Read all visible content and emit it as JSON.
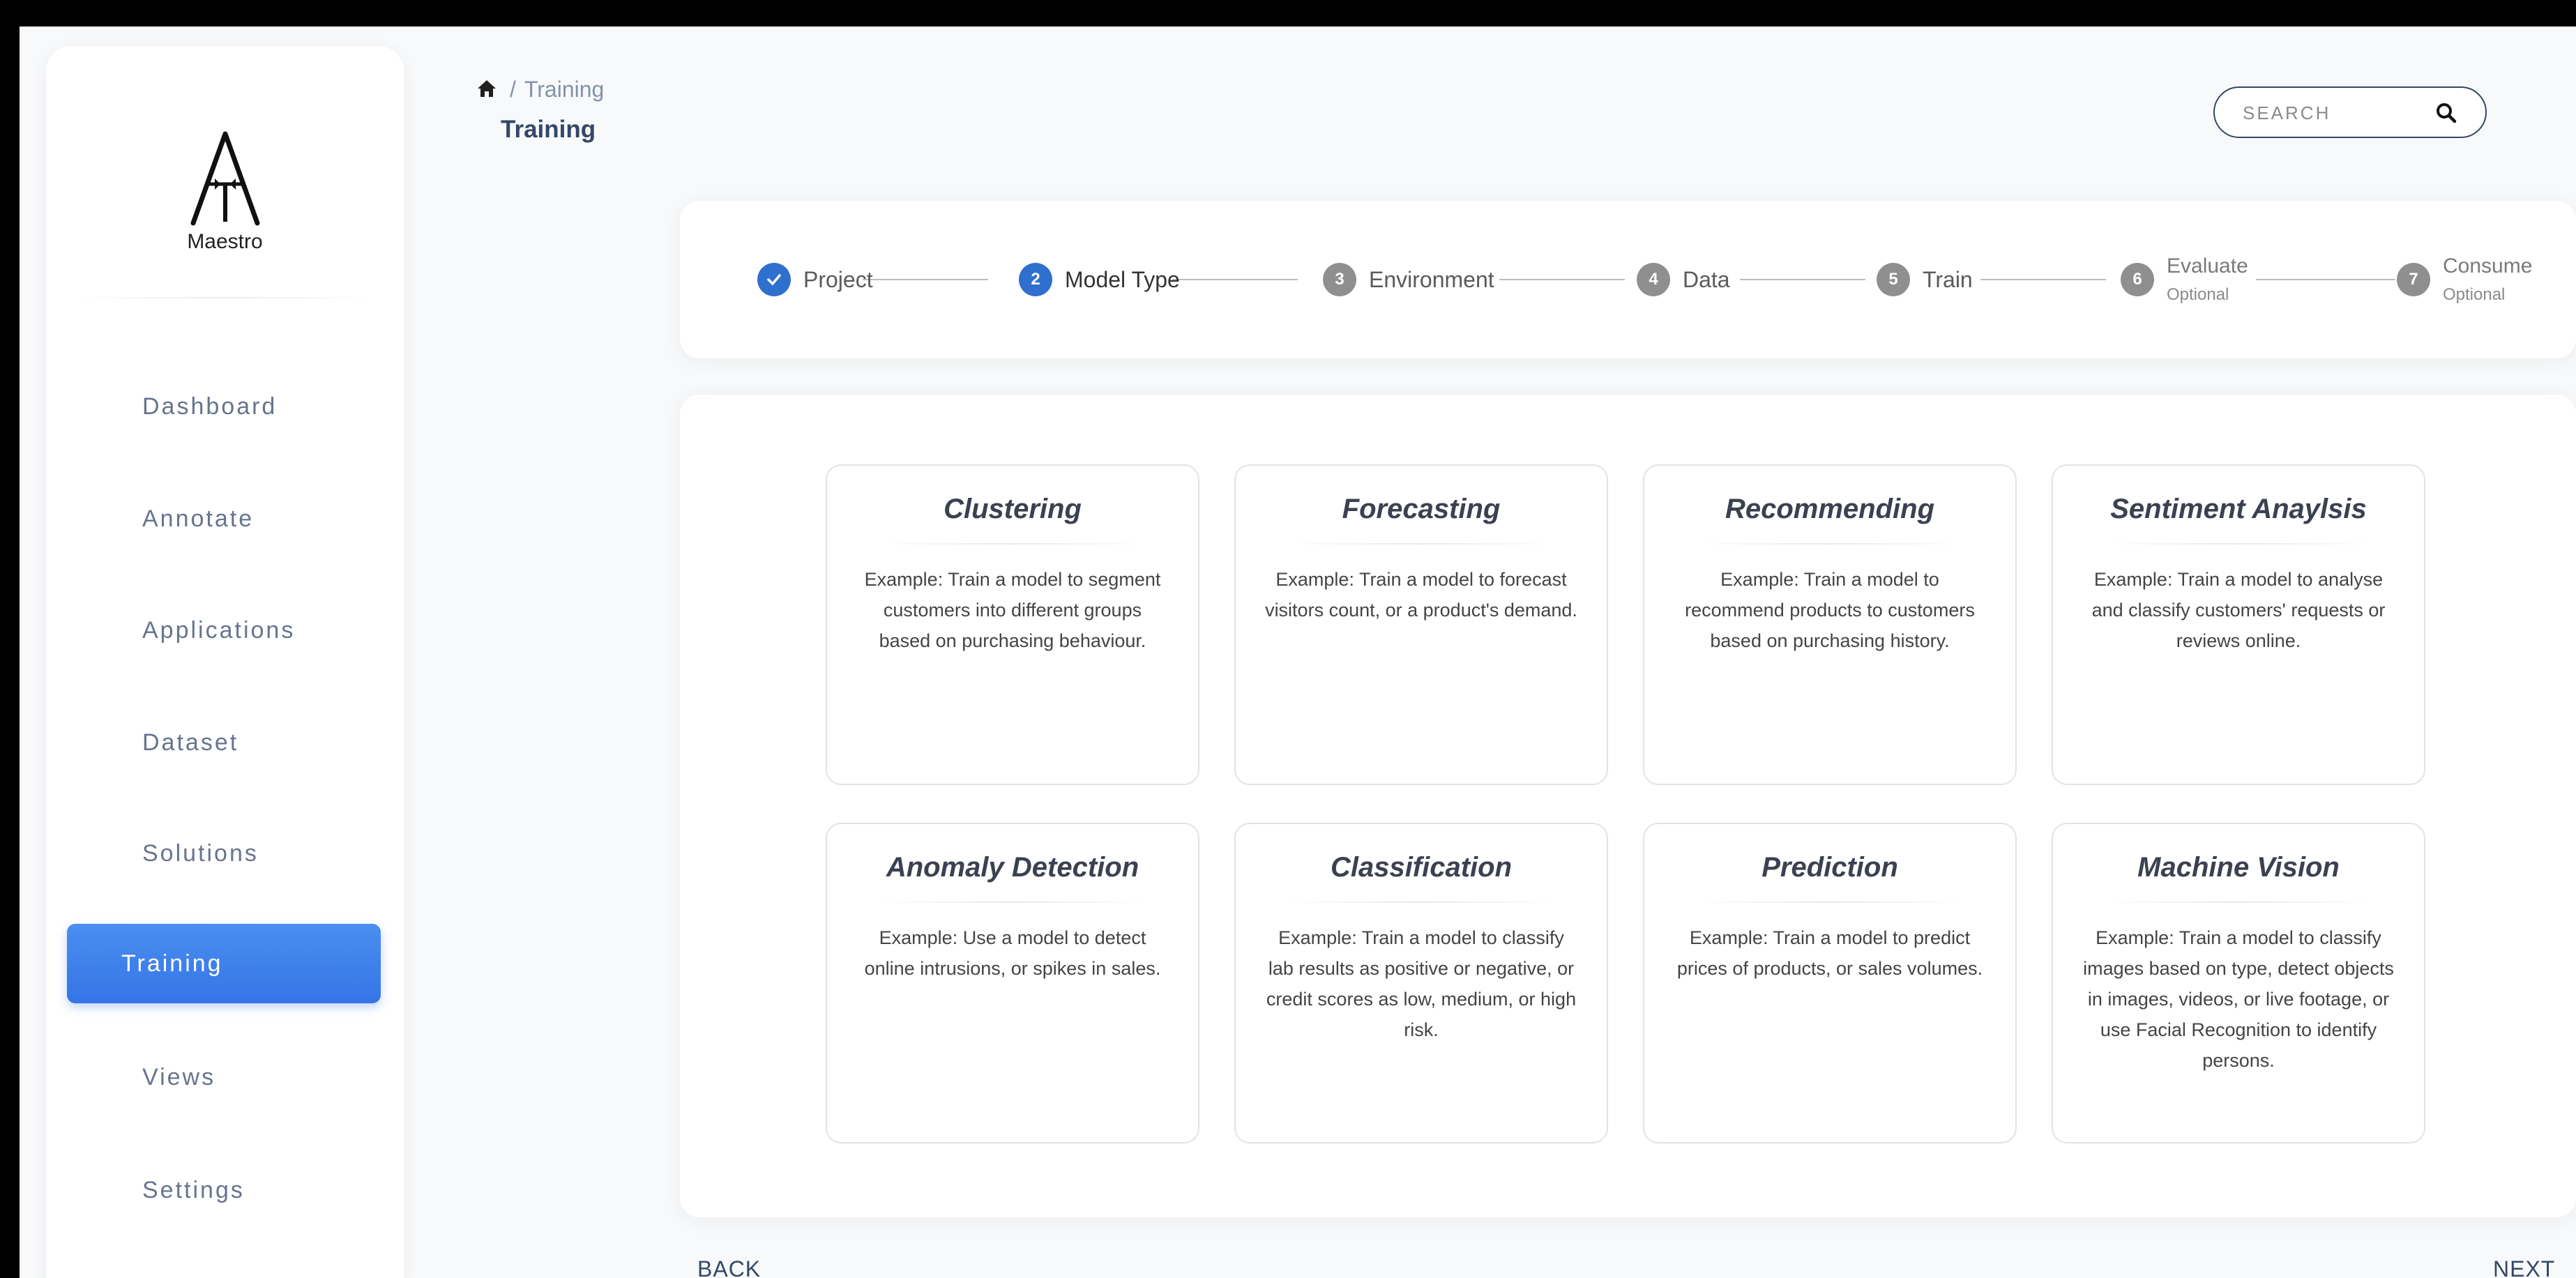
{
  "brand": {
    "name": "Maestro"
  },
  "sidebar": {
    "items": [
      {
        "label": "Dashboard"
      },
      {
        "label": "Annotate"
      },
      {
        "label": "Applications"
      },
      {
        "label": "Dataset"
      },
      {
        "label": "Solutions"
      },
      {
        "label": "Training",
        "active": true
      },
      {
        "label": "Views"
      },
      {
        "label": "Settings"
      }
    ]
  },
  "header": {
    "breadcrumb": {
      "home_icon": "home-icon",
      "separator": "/",
      "current": "Training"
    },
    "title": "Training",
    "search": {
      "placeholder": "SEARCH",
      "value": "",
      "icon": "search-icon"
    }
  },
  "stepper": {
    "steps": [
      {
        "number": "1",
        "label": "Project",
        "status": "completed",
        "sub": ""
      },
      {
        "number": "2",
        "label": "Model Type",
        "status": "current",
        "sub": ""
      },
      {
        "number": "3",
        "label": "Environment",
        "status": "pending",
        "sub": ""
      },
      {
        "number": "4",
        "label": "Data",
        "status": "pending",
        "sub": ""
      },
      {
        "number": "5",
        "label": "Train",
        "status": "pending",
        "sub": ""
      },
      {
        "number": "6",
        "label": "Evaluate",
        "status": "pending",
        "sub": "Optional"
      },
      {
        "number": "7",
        "label": "Consume",
        "status": "pending",
        "sub": "Optional"
      }
    ]
  },
  "model_types": [
    {
      "title": "Clustering",
      "description": "Example: Train a model to segment customers into different groups based on purchasing behaviour."
    },
    {
      "title": "Forecasting",
      "description": "Example: Train a model to forecast visitors count, or a product's demand."
    },
    {
      "title": "Recommending",
      "description": "Example: Train a model to recommend products to customers based on purchasing history."
    },
    {
      "title": "Sentiment Anaylsis",
      "description": "Example: Train a model to analyse and classify customers' requests or reviews online."
    },
    {
      "title": "Anomaly Detection",
      "description": "Example: Use a model to detect online intrusions, or spikes in sales."
    },
    {
      "title": "Classification",
      "description": "Example: Train a model to classify lab results as positive or negative, or credit scores as low, medium, or high risk."
    },
    {
      "title": "Prediction",
      "description": "Example: Train a model to predict prices of products, or sales volumes."
    },
    {
      "title": "Machine Vision",
      "description": "Example: Train a model to classify images based on type, detect objects in images, videos, or live footage, or use Facial Recognition to identify persons."
    }
  ],
  "footer": {
    "back_label": "BACK",
    "next_label": "NEXT"
  },
  "colors": {
    "accent": "#3574e6",
    "step_active": "#2f6fce",
    "step_inactive": "#8f8f8f",
    "text": "#344767"
  }
}
